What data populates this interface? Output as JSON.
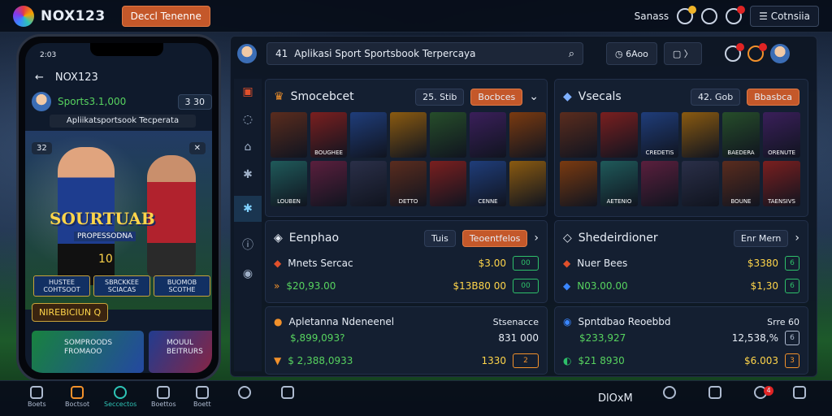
{
  "header": {
    "brand": "NOX123",
    "cta_label": "Deccl Tenenne",
    "session_label": "Sanass",
    "account_label": "Cotnsiia"
  },
  "phone": {
    "time": "2:03",
    "title": "NOX123",
    "balance_label": "Sports3.1,000",
    "balance_pill": "3 30",
    "banner": "Apliikatsportsook Tecperata",
    "badge_left": "32",
    "hero_title": "SOURTUAB",
    "hero_sub": "PROPESSODNA",
    "hero_number": "10",
    "cards": [
      "HUSTEE COHTSOOT",
      "SBRCKKEE SCIACAS",
      "BUOMOB SCOTHE"
    ],
    "promo": "NIREBICIUN Q",
    "tiles": [
      "SOMPROODS FROMAOO",
      "MOUUL BEITRURS"
    ],
    "nav": [
      "Boets",
      "Boctsot",
      "Seccectos",
      "Boettos",
      "Boett"
    ]
  },
  "main": {
    "search_prefix": "41",
    "search_text": "Aplikasi Sport Sportsbook Terpercaya",
    "btn_one": "6Aoo",
    "sportsbook": {
      "title": "Smocebcet",
      "chip": "25. Stib",
      "chip_orange": "Bocbces",
      "tiles": [
        "",
        "BOUGHEE",
        "",
        "",
        "",
        "",
        "",
        "LOUBEN",
        "",
        "",
        "DETTO",
        "",
        "CENNE",
        ""
      ]
    },
    "specials": {
      "title": "Vsecals",
      "chip": "42. Gob",
      "chip_orange": "Bbasbca",
      "tiles": [
        "",
        "",
        "CREDETIS",
        "",
        "BAEDERA",
        "ORENUTE",
        "",
        "AETENIO",
        "",
        "",
        "BOUNE",
        "TAENSIVS"
      ]
    },
    "bets_left": {
      "title": "Eenphao",
      "chip": "Tuis",
      "chip_orange": "Teoentfelos",
      "rows": [
        {
          "label": "Mnets Sercac",
          "value": "$3.00",
          "odd": "00"
        },
        {
          "label": "$20,93.00",
          "value": "$13B80 00",
          "odd": "00"
        }
      ]
    },
    "bets_right": {
      "title": "Shedeirdioner",
      "chip": "Enr Mern",
      "rows": [
        {
          "label": "Nuer Bees",
          "value": "$3380",
          "odd": "6"
        },
        {
          "label": "N03.00.00",
          "value": "$1,30",
          "odd": "6"
        }
      ]
    },
    "live_left": {
      "title": "Apletanna Ndeneenel",
      "right_label": "Stsenacce",
      "rows": [
        {
          "label": "$,899,093?",
          "value": "831 000",
          "odd": ""
        },
        {
          "label": "$ 2,388,0933",
          "value": "1330",
          "odd": "2"
        }
      ]
    },
    "live_right": {
      "title": "Spntdbao Reoebbd",
      "right_label": "Srre 60",
      "rows": [
        {
          "label": "$233,927",
          "value": "12,538,%",
          "odd": "6"
        },
        {
          "label": "$21 8930",
          "value": "$6.003",
          "odd": "3"
        }
      ]
    }
  },
  "bottom": {
    "left_nav": [
      "Boets",
      "Boctsot",
      "Seccectos",
      "Boettos",
      "Boett"
    ],
    "mid_label": "DlOxM",
    "badge_count": "4"
  }
}
